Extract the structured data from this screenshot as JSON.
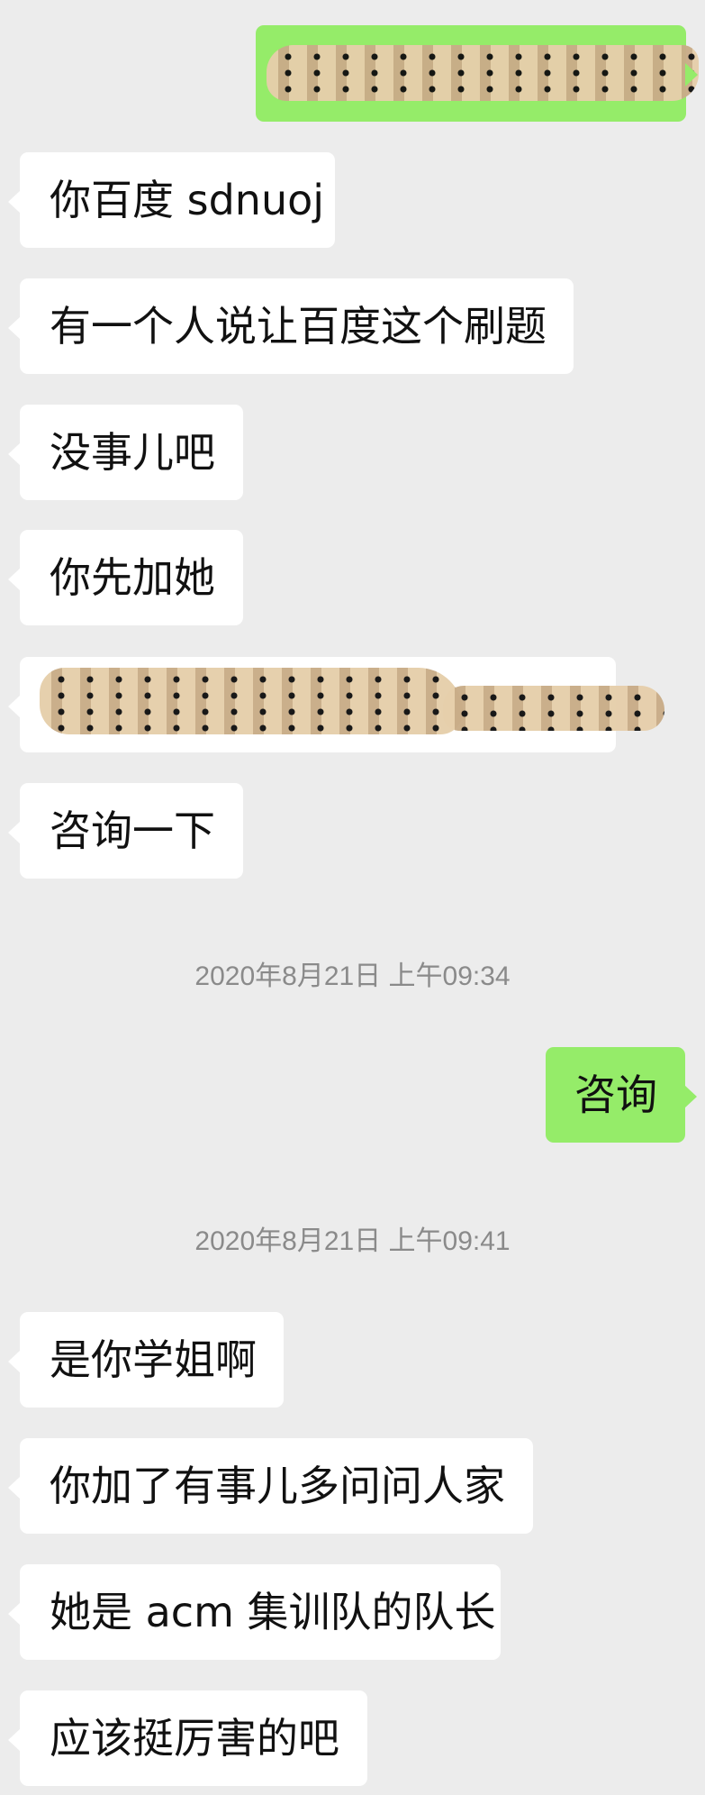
{
  "messages": [
    {
      "side": "out",
      "text": "",
      "redacted": true
    },
    {
      "side": "in",
      "text": "你百度 sdnuoj"
    },
    {
      "side": "in",
      "text": "有一个人说让百度这个刷题"
    },
    {
      "side": "in",
      "text": "没事儿吧"
    },
    {
      "side": "in",
      "text": "你先加她"
    },
    {
      "side": "in",
      "text": "",
      "redacted": true
    },
    {
      "side": "in",
      "text": "咨询一下"
    },
    {
      "type": "timestamp",
      "text": "2020年8月21日 上午09:34"
    },
    {
      "side": "out",
      "text": "咨询"
    },
    {
      "type": "timestamp",
      "text": "2020年8月21日 上午09:41"
    },
    {
      "side": "in",
      "text": "是你学姐啊"
    },
    {
      "side": "in",
      "text": "你加了有事儿多问问人家"
    },
    {
      "side": "in",
      "text": "她是 acm 集训队的队长"
    },
    {
      "side": "in",
      "text": "应该挺厉害的吧"
    }
  ],
  "colors": {
    "background": "#ececec",
    "incoming_bubble": "#ffffff",
    "outgoing_bubble": "#95ec69",
    "timestamp_text": "#8a8a8a"
  }
}
